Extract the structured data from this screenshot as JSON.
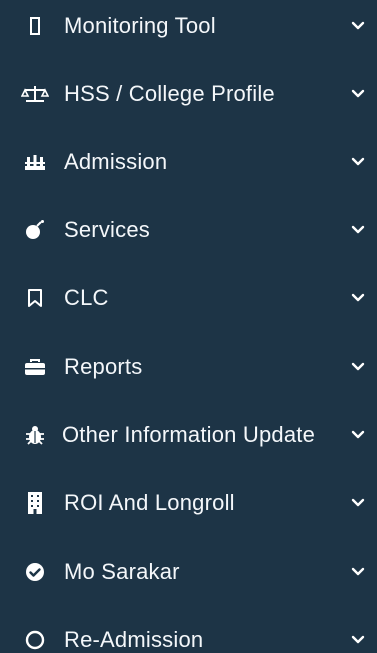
{
  "sidebar": {
    "items": [
      {
        "label": "Monitoring Tool",
        "icon": "square-icon"
      },
      {
        "label": "HSS / College Profile",
        "icon": "balance-scale-icon"
      },
      {
        "label": "Admission",
        "icon": "school-building-icon"
      },
      {
        "label": "Services",
        "icon": "bomb-icon"
      },
      {
        "label": "CLC",
        "icon": "bookmark-icon"
      },
      {
        "label": "Reports",
        "icon": "briefcase-icon"
      },
      {
        "label": "Other Information Update",
        "icon": "bug-icon"
      },
      {
        "label": "ROI And Longroll",
        "icon": "building-icon"
      },
      {
        "label": "Mo Sarakar",
        "icon": "check-circle-icon"
      },
      {
        "label": "Re-Admission",
        "icon": "circle-icon"
      }
    ],
    "chevron_icon": "chevron-down-icon",
    "colors": {
      "background": "#1d3446",
      "text": "#f4f7fa",
      "icon": "#ffffff"
    }
  }
}
